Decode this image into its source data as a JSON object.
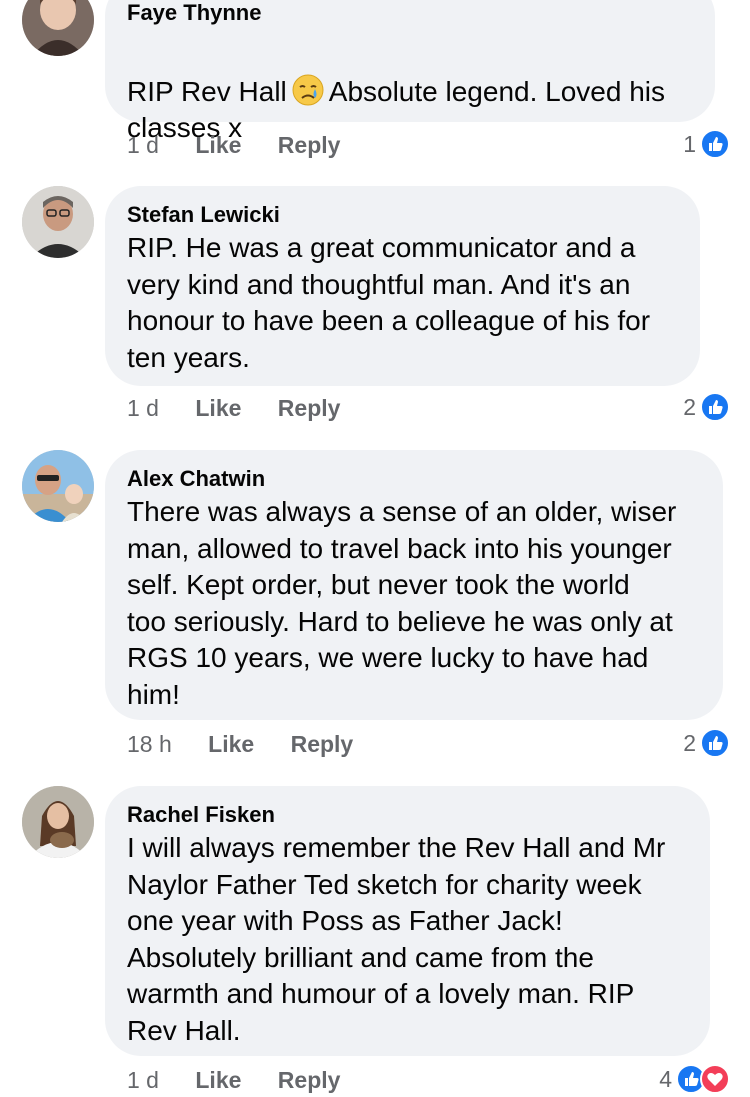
{
  "comments": [
    {
      "author": "Faye Thynne",
      "text_before": "RIP Rev Hall",
      "emoji": "crying-face-emoji",
      "text_after": "Absolute legend. Loved his\nclasses x",
      "time": "1 d",
      "like_label": "Like",
      "reply_label": "Reply",
      "reaction_count": "1",
      "reactions": [
        "like"
      ]
    },
    {
      "author": "Stefan Lewicki",
      "text": "RIP. He was a great communicator and a\nvery kind and thoughtful man. And it's an\nhonour to have been a colleague of his for\nten years.",
      "time": "1 d",
      "like_label": "Like",
      "reply_label": "Reply",
      "reaction_count": "2",
      "reactions": [
        "like"
      ]
    },
    {
      "author": "Alex Chatwin",
      "text": "There was always a sense of an older, wiser\nman, allowed to travel back into his younger\nself. Kept order, but never took the world\ntoo seriously. Hard to believe he was only at\nRGS 10 years, we were lucky to have had\nhim!",
      "time": "18 h",
      "like_label": "Like",
      "reply_label": "Reply",
      "reaction_count": "2",
      "reactions": [
        "like"
      ]
    },
    {
      "author": "Rachel Fisken",
      "text": "I will always remember the Rev Hall and Mr\nNaylor Father Ted sketch for charity week\none year with Poss as Father Jack!\nAbsolutely brilliant and came from the\nwarmth and humour of a lovely man. RIP\nRev Hall.",
      "time": "1 d",
      "like_label": "Like",
      "reply_label": "Reply",
      "reaction_count": "4",
      "reactions": [
        "like",
        "love"
      ]
    }
  ],
  "colors": {
    "bubble": "#f0f2f5",
    "meta_text": "#65676b",
    "like_blue": "#1877f2",
    "love_red": "#f33e58"
  }
}
